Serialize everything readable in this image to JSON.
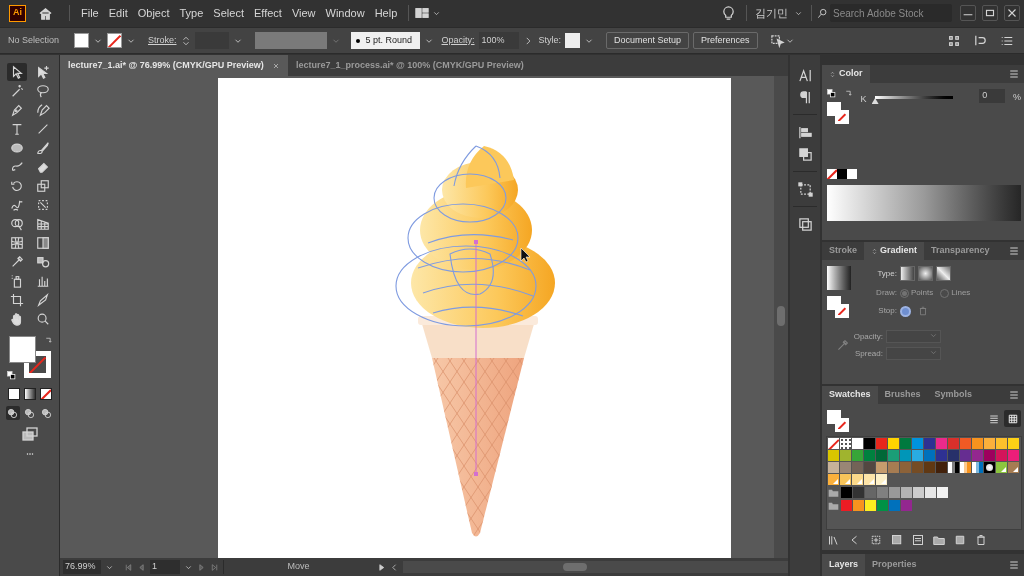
{
  "menu_bar": {
    "app_logo": "Ai",
    "menus": [
      "File",
      "Edit",
      "Object",
      "Type",
      "Select",
      "Effect",
      "View",
      "Window",
      "Help"
    ],
    "user": "김기민",
    "search": {
      "placeholder": "Search Adobe Stock"
    }
  },
  "control_bar": {
    "selection": "No Selection",
    "stroke_label": "Stroke:",
    "brush": "5 pt. Round",
    "opacity_label": "Opacity:",
    "opacity": "100%",
    "style_label": "Style:",
    "buttons": [
      "Document Setup",
      "Preferences"
    ]
  },
  "tabs": [
    {
      "label": "lecture7_1.ai* @ 76.99% (CMYK/GPU Preview)",
      "selected": true
    },
    {
      "label": "lecture7_1_process.ai* @ 100% (CMYK/GPU Preview)",
      "selected": false
    }
  ],
  "tools": [
    {
      "selected": true
    },
    {
      "selected": false
    },
    {
      "selected": false
    },
    {
      "selected": false
    },
    {
      "selected": false
    },
    {
      "selected": false
    },
    {
      "selected": false
    },
    {
      "selected": false
    },
    {
      "selected": false
    },
    {
      "selected": false
    },
    {
      "selected": false
    },
    {
      "selected": false
    },
    {
      "selected": false
    },
    {
      "selected": false
    },
    {
      "selected": false
    },
    {
      "selected": false
    },
    {
      "selected": false
    },
    {
      "selected": false
    },
    {
      "selected": false
    },
    {
      "selected": false
    },
    {
      "selected": false
    },
    {
      "selected": false
    },
    {
      "selected": false
    },
    {
      "selected": false
    },
    {
      "selected": false
    },
    {
      "selected": false
    },
    {
      "selected": false
    },
    {
      "selected": false
    }
  ],
  "draw_modes": [
    {
      "selected": true
    },
    {
      "selected": false
    },
    {
      "selected": false
    }
  ],
  "color_panel": {
    "title": "Color",
    "channel": "K",
    "level": 0,
    "value": "0",
    "unit": "%"
  },
  "gradient_panel": {
    "tabs": [
      {
        "label": "Stroke",
        "selected": false
      },
      {
        "label": "Gradient",
        "selected": true
      },
      {
        "label": "Transparency",
        "selected": false
      }
    ],
    "type_label": "Type:",
    "draw_label": "Draw:",
    "draw_options": [
      {
        "label": "Points",
        "selected": true
      },
      {
        "label": "Lines",
        "selected": false
      }
    ],
    "stop_label": "Stop:",
    "opacity_label": "Opacity:",
    "spread_label": "Spread:",
    "disabled": true
  },
  "swatches_panel": {
    "tabs": [
      {
        "label": "Swatches",
        "selected": true
      },
      {
        "label": "Brushes",
        "selected": false
      },
      {
        "label": "Symbols",
        "selected": false
      }
    ],
    "view_modes": [
      {
        "selected": false
      },
      {
        "selected": true
      }
    ],
    "rows": [
      [
        {
          "kind": "none"
        },
        {
          "kind": "registration"
        },
        {
          "kind": "color",
          "color": "#ffffff"
        },
        {
          "kind": "color",
          "color": "#000000"
        },
        {
          "kind": "color",
          "color": "#e8261c"
        },
        {
          "kind": "color",
          "color": "#ffd400"
        },
        {
          "kind": "color",
          "color": "#00793e"
        },
        {
          "kind": "color",
          "color": "#0093dd"
        },
        {
          "kind": "color",
          "color": "#2e3192"
        },
        {
          "kind": "color",
          "color": "#ea2a8b"
        },
        {
          "kind": "color",
          "color": "#d9302b"
        },
        {
          "kind": "color",
          "color": "#f15a24"
        },
        {
          "kind": "color",
          "color": "#f7931e"
        },
        {
          "kind": "color",
          "color": "#fbb03b"
        },
        {
          "kind": "color",
          "color": "#fcc02c"
        },
        {
          "kind": "color",
          "color": "#fcd116"
        }
      ],
      [
        {
          "kind": "color",
          "color": "#d9c500"
        },
        {
          "kind": "color",
          "color": "#a0b42e"
        },
        {
          "kind": "color",
          "color": "#37a538"
        },
        {
          "kind": "color",
          "color": "#00813f"
        },
        {
          "kind": "color",
          "color": "#006837"
        },
        {
          "kind": "color",
          "color": "#1a9e77"
        },
        {
          "kind": "color",
          "color": "#0096b8"
        },
        {
          "kind": "color",
          "color": "#29abe2"
        },
        {
          "kind": "color",
          "color": "#0071bc"
        },
        {
          "kind": "color",
          "color": "#2e3192"
        },
        {
          "kind": "color",
          "color": "#27306a"
        },
        {
          "kind": "color",
          "color": "#662d91"
        },
        {
          "kind": "color",
          "color": "#93278f"
        },
        {
          "kind": "color",
          "color": "#9e005d"
        },
        {
          "kind": "color",
          "color": "#d4145a"
        },
        {
          "kind": "color",
          "color": "#ed1e79"
        }
      ],
      [
        {
          "kind": "color",
          "color": "#c7b299"
        },
        {
          "kind": "color",
          "color": "#998675"
        },
        {
          "kind": "color",
          "color": "#736357"
        },
        {
          "kind": "color",
          "color": "#534741"
        },
        {
          "kind": "color",
          "color": "#c69c6d"
        },
        {
          "kind": "color",
          "color": "#a67c52"
        },
        {
          "kind": "color",
          "color": "#8c6239"
        },
        {
          "kind": "color",
          "color": "#754c24"
        },
        {
          "kind": "color",
          "color": "#603813"
        },
        {
          "kind": "color",
          "color": "#42210b"
        },
        {
          "kind": "gradient",
          "color": "#000000"
        },
        {
          "kind": "gradient",
          "color": "#f7931e"
        },
        {
          "kind": "gradient",
          "color": "#0071bc"
        },
        {
          "kind": "radial",
          "color": "#000000"
        },
        {
          "kind": "pattern",
          "color": "#8cc63f"
        },
        {
          "kind": "pattern",
          "color": "#a67c52"
        }
      ],
      [
        {
          "kind": "pattern",
          "color": "#fbb03b"
        },
        {
          "kind": "pattern",
          "color": "#f7c45a"
        },
        {
          "kind": "pattern",
          "color": "#fcd98a"
        },
        {
          "kind": "pattern",
          "color": "#fde4a8"
        },
        {
          "kind": "pattern",
          "color": "#fdf0c8"
        }
      ]
    ],
    "groups": [
      [
        {
          "color": "#000000"
        },
        {
          "color": "#333333"
        },
        {
          "color": "#666666"
        },
        {
          "color": "#808080"
        },
        {
          "color": "#999999"
        },
        {
          "color": "#b3b3b3"
        },
        {
          "color": "#cccccc"
        },
        {
          "color": "#e6e6e6"
        },
        {
          "color": "#f2f2f2"
        }
      ],
      [
        {
          "color": "#ed1c24"
        },
        {
          "color": "#f7931e"
        },
        {
          "color": "#fcee21"
        },
        {
          "color": "#009245"
        },
        {
          "color": "#0071bc"
        },
        {
          "color": "#93278f"
        }
      ]
    ]
  },
  "layers_panel": {
    "tabs": [
      {
        "label": "Layers",
        "selected": true
      },
      {
        "label": "Properties",
        "selected": false
      }
    ]
  },
  "status_bar": {
    "zoom": "76.99%",
    "page": "1",
    "tool": "Move"
  }
}
